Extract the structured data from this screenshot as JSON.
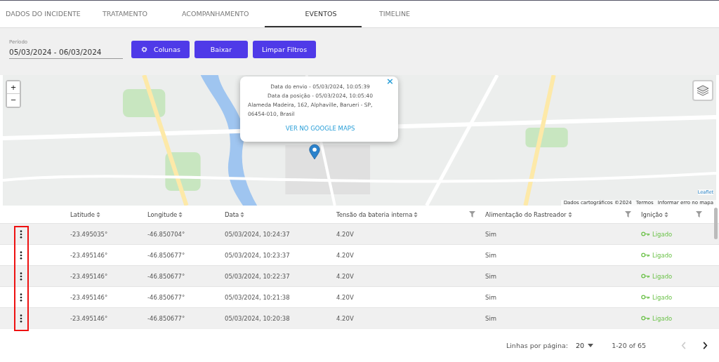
{
  "tabs": [
    {
      "label": "DADOS DO INCIDENTE",
      "selected": false
    },
    {
      "label": "TRATAMENTO",
      "selected": false
    },
    {
      "label": "ACOMPANHAMENTO",
      "selected": false
    },
    {
      "label": "EVENTOS",
      "selected": true
    },
    {
      "label": "TIMELINE",
      "selected": false
    }
  ],
  "filters": {
    "period_label": "Período",
    "period_value": "05/03/2024 - 06/03/2024",
    "buttons": [
      {
        "label": "Colunas",
        "kind": "gear"
      },
      {
        "label": "Baixar",
        "kind": "plain"
      },
      {
        "label": "Limpar Filtros",
        "kind": "plain"
      }
    ]
  },
  "map": {
    "zoom_in": "+",
    "zoom_out": "−",
    "popup": {
      "lines": [
        "Data do envio - 05/03/2024, 10:05:39",
        "Data da posição - 05/03/2024, 10:05:40"
      ],
      "address": "Alameda Madeira, 162, Alphaville, Barueri - SP, 06454-010, Brasil",
      "link": "VER NO GOOGLE MAPS",
      "close": "×"
    },
    "attribution_link": "Leaflet",
    "attribution": [
      "Dados cartográficos ©2024",
      "Termos",
      "Informar erro no mapa"
    ]
  },
  "table": {
    "columns": [
      {
        "label": "Latitude",
        "filter": false
      },
      {
        "label": "Longitude",
        "filter": false
      },
      {
        "label": "Data",
        "filter": false
      },
      {
        "label": "Tensão da bateria interna",
        "filter": true
      },
      {
        "label": "Alimentação do Rastreador",
        "filter": true
      },
      {
        "label": "Ignição",
        "filter": true
      }
    ],
    "rows": [
      {
        "cells": [
          "-23.495035°",
          "-46.850704°",
          "05/03/2024, 10:24:37",
          "4.20V",
          "Sim",
          "Ligado"
        ]
      },
      {
        "cells": [
          "-23.495146°",
          "-46.850677°",
          "05/03/2024, 10:23:37",
          "4.20V",
          "Sim",
          "Ligado"
        ]
      },
      {
        "cells": [
          "-23.495146°",
          "-46.850677°",
          "05/03/2024, 10:22:37",
          "4.20V",
          "Sim",
          "Ligado"
        ]
      },
      {
        "cells": [
          "-23.495146°",
          "-46.850677°",
          "05/03/2024, 10:21:38",
          "4.20V",
          "Sim",
          "Ligado"
        ]
      },
      {
        "cells": [
          "-23.495146°",
          "-46.850677°",
          "05/03/2024, 10:20:38",
          "4.20V",
          "Sim",
          "Ligado"
        ]
      }
    ]
  },
  "pagination": {
    "rows_label": "Linhas por página:",
    "rows_value": "20",
    "range": "1-20 of 65",
    "prev_disabled": true,
    "next_disabled": false
  }
}
